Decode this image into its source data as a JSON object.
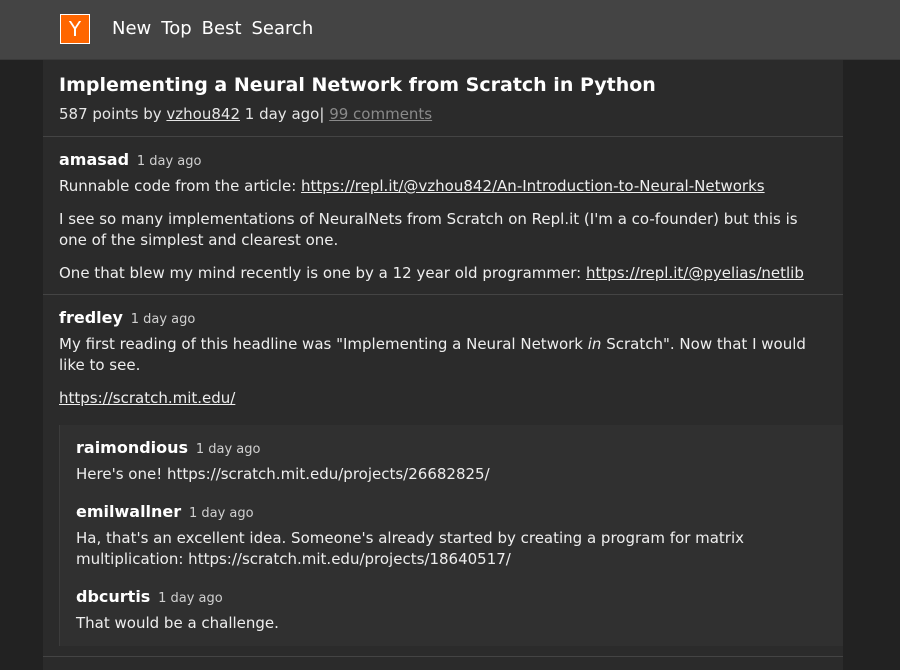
{
  "header": {
    "logo": "Y",
    "nav": [
      "New",
      "Top",
      "Best",
      "Search"
    ]
  },
  "story": {
    "title": "Implementing a Neural Network from Scratch in Python",
    "points_by": "587 points by",
    "author": "vzhou842",
    "time": "1 day ago",
    "separator": "|",
    "comments": "99 comments"
  },
  "comments": [
    {
      "user": "amasad",
      "time": "1 day ago",
      "p1_prefix": "Runnable code from the article: ",
      "p1_link": "https://repl.it/@vzhou842/An-Introduction-to-Neural-Networks",
      "p2": "I see so many implementations of NeuralNets from Scratch on Repl.it (I'm a co-founder) but this is one of the simplest and clearest one.",
      "p3_prefix": "One that blew my mind recently is one by a 12 year old programmer: ",
      "p3_link": "https://repl.it/@pyelias/netlib"
    },
    {
      "user": "fredley",
      "time": "1 day ago",
      "p1_a": "My first reading of this headline was \"Implementing a Neural Network ",
      "p1_em": "in",
      "p1_b": " Scratch\". Now that I would like to see.",
      "p2_link": "https://scratch.mit.edu/",
      "replies": [
        {
          "user": "raimondious",
          "time": "1 day ago",
          "text": "Here's one! https://scratch.mit.edu/projects/26682825/"
        },
        {
          "user": "emilwallner",
          "time": "1 day ago",
          "text": "Ha, that's an excellent idea. Someone's already started by creating a program for matrix multiplication: https://scratch.mit.edu/projects/18640517/"
        },
        {
          "user": "dbcurtis",
          "time": "1 day ago",
          "text": "That would be a challenge."
        }
      ]
    }
  ]
}
